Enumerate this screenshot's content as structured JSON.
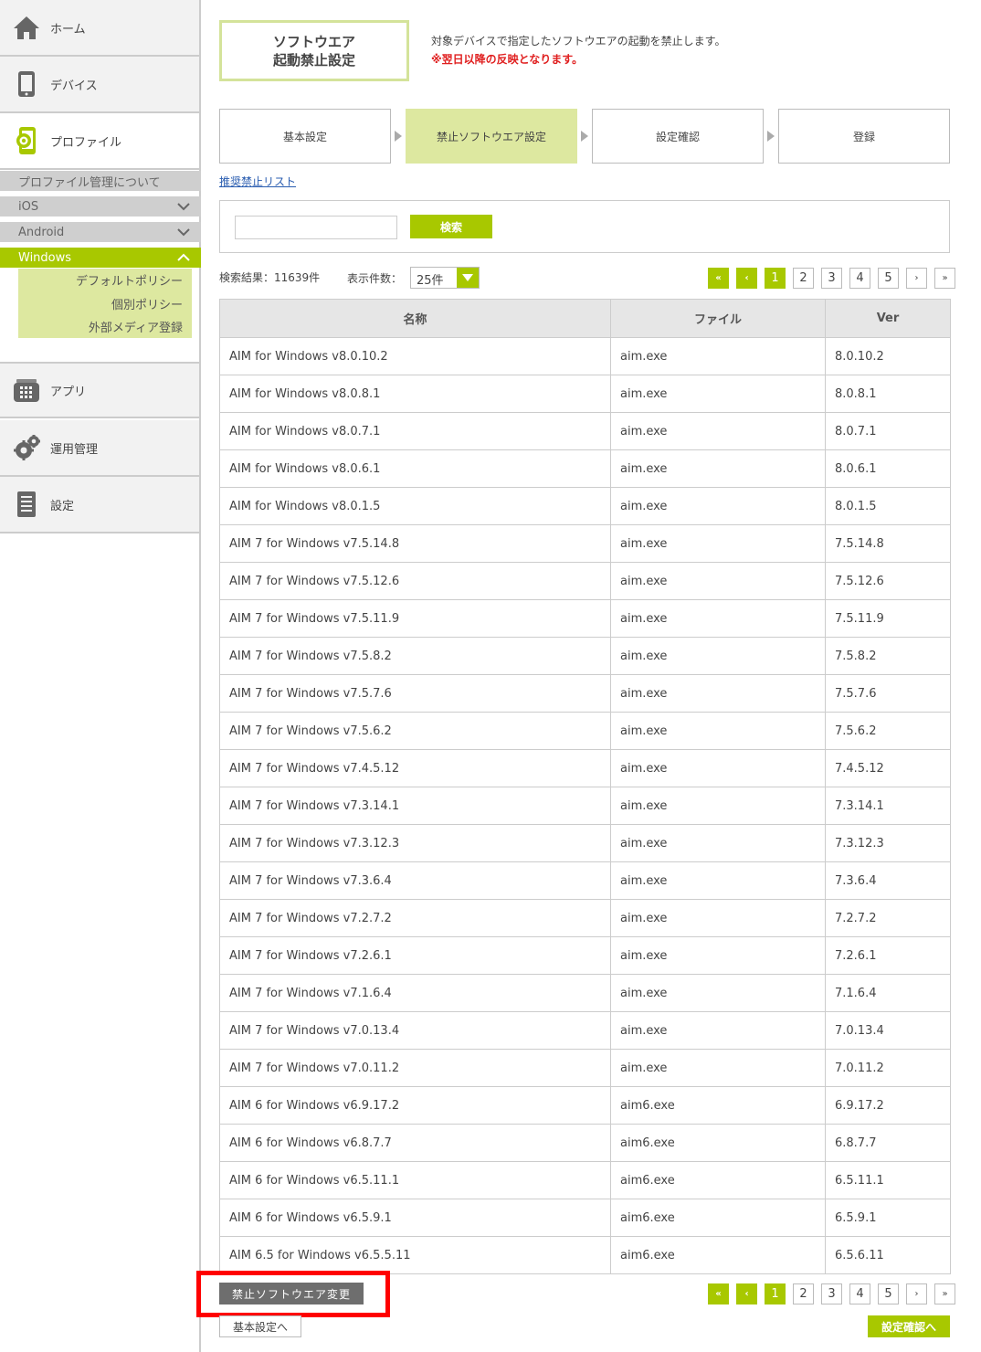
{
  "sidebar": {
    "home": "ホーム",
    "device": "デバイス",
    "profile": "プロファイル",
    "profile_about": "プロファイル管理について",
    "ios": "iOS",
    "android": "Android",
    "windows": "Windows",
    "default_policy": "デフォルトポリシー",
    "individual_policy": "個別ポリシー",
    "external_media": "外部メディア登録",
    "app": "アプリ",
    "operations": "運用管理",
    "settings": "設定"
  },
  "title": {
    "line1": "ソフトウエア",
    "line2": "起動禁止設定",
    "description": "対象デバイスで指定したソフトウエアの起動を禁止します。",
    "warning": "※翌日以降の反映となります。"
  },
  "steps": [
    "基本設定",
    "禁止ソフトウエア設定",
    "設定確認",
    "登録"
  ],
  "recommended_link": "推奨禁止リスト",
  "search": {
    "value": "",
    "button": "検索"
  },
  "results": {
    "label": "検索結果：11639件",
    "count_label": "表示件数：",
    "count_value": "25件"
  },
  "pager": {
    "first": "«",
    "prev": "‹",
    "pages": [
      "1",
      "2",
      "3",
      "4",
      "5"
    ],
    "next": "›",
    "last": "»"
  },
  "table": {
    "headers": [
      "名称",
      "ファイル",
      "Ver"
    ],
    "rows": [
      [
        "AIM for Windows v8.0.10.2",
        "aim.exe",
        "8.0.10.2"
      ],
      [
        "AIM for Windows v8.0.8.1",
        "aim.exe",
        "8.0.8.1"
      ],
      [
        "AIM for Windows v8.0.7.1",
        "aim.exe",
        "8.0.7.1"
      ],
      [
        "AIM for Windows v8.0.6.1",
        "aim.exe",
        "8.0.6.1"
      ],
      [
        "AIM for Windows v8.0.1.5",
        "aim.exe",
        "8.0.1.5"
      ],
      [
        "AIM 7 for Windows v7.5.14.8",
        "aim.exe",
        "7.5.14.8"
      ],
      [
        "AIM 7 for Windows v7.5.12.6",
        "aim.exe",
        "7.5.12.6"
      ],
      [
        "AIM 7 for Windows v7.5.11.9",
        "aim.exe",
        "7.5.11.9"
      ],
      [
        "AIM 7 for Windows v7.5.8.2",
        "aim.exe",
        "7.5.8.2"
      ],
      [
        "AIM 7 for Windows v7.5.7.6",
        "aim.exe",
        "7.5.7.6"
      ],
      [
        "AIM 7 for Windows v7.5.6.2",
        "aim.exe",
        "7.5.6.2"
      ],
      [
        "AIM 7 for Windows v7.4.5.12",
        "aim.exe",
        "7.4.5.12"
      ],
      [
        "AIM 7 for Windows v7.3.14.1",
        "aim.exe",
        "7.3.14.1"
      ],
      [
        "AIM 7 for Windows v7.3.12.3",
        "aim.exe",
        "7.3.12.3"
      ],
      [
        "AIM 7 for Windows v7.3.6.4",
        "aim.exe",
        "7.3.6.4"
      ],
      [
        "AIM 7 for Windows v7.2.7.2",
        "aim.exe",
        "7.2.7.2"
      ],
      [
        "AIM 7 for Windows v7.2.6.1",
        "aim.exe",
        "7.2.6.1"
      ],
      [
        "AIM 7 for Windows v7.1.6.4",
        "aim.exe",
        "7.1.6.4"
      ],
      [
        "AIM 7 for Windows v7.0.13.4",
        "aim.exe",
        "7.0.13.4"
      ],
      [
        "AIM 7 for Windows v7.0.11.2",
        "aim.exe",
        "7.0.11.2"
      ],
      [
        "AIM 6 for Windows v6.9.17.2",
        "aim6.exe",
        "6.9.17.2"
      ],
      [
        "AIM 6 for Windows v6.8.7.7",
        "aim6.exe",
        "6.8.7.7"
      ],
      [
        "AIM 6 for Windows v6.5.11.1",
        "aim6.exe",
        "6.5.11.1"
      ],
      [
        "AIM 6 for Windows v6.5.9.1",
        "aim6.exe",
        "6.5.9.1"
      ],
      [
        "AIM 6.5 for Windows v6.5.5.11",
        "aim6.exe",
        "6.5.6.11"
      ]
    ]
  },
  "actions": {
    "change": "禁止ソフトウエア変更",
    "back": "基本設定へ",
    "next": "設定確認へ"
  },
  "colors": {
    "accent": "#a8c800",
    "accent_light": "#dde8a0",
    "warning": "#e02020",
    "highlight": "#ff0000"
  }
}
